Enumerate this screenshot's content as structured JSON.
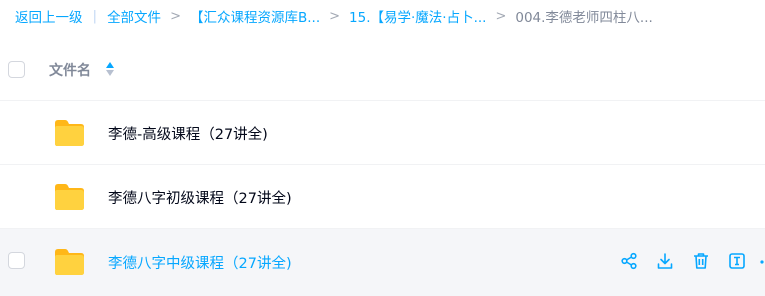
{
  "breadcrumb": {
    "back": "返回上一级",
    "all_files": "全部文件",
    "level1": "【汇众课程资源库B...",
    "level2": "15.【易学·魔法·占卜...",
    "current": "004.李德老师四柱八..."
  },
  "list": {
    "column_name": "文件名",
    "rows": [
      {
        "name": "李德-高级课程（27讲全)",
        "icon": "folder-icon"
      },
      {
        "name": "李德八字初级课程（27讲全)",
        "icon": "folder-icon"
      },
      {
        "name": "李德八字中级课程（27讲全)",
        "icon": "folder-icon"
      }
    ]
  },
  "row_actions": [
    "share-icon",
    "download-icon",
    "delete-icon",
    "rename-icon",
    "more-icon"
  ],
  "colors": {
    "accent": "#06a7ff",
    "text": "#03081a",
    "muted": "#818999",
    "folder": "#ffc531",
    "hover_row": "#f5f6f9"
  }
}
